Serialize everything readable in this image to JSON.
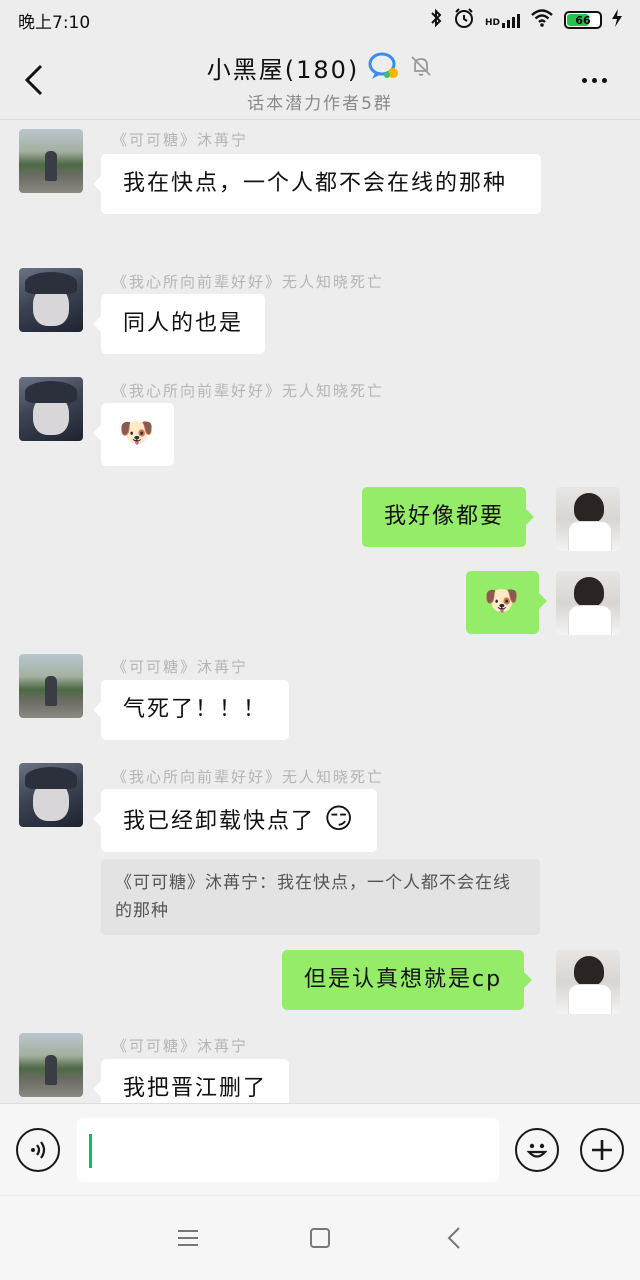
{
  "status_bar": {
    "time": "晚上7:10",
    "icons": [
      "bluetooth-icon",
      "alarm-icon",
      "hd-signal-icon",
      "wifi-icon",
      "battery-icon",
      "charging-icon"
    ],
    "network_label": "HD",
    "battery": "66",
    "battery_level_percent": 66
  },
  "header": {
    "title": "小黑屋(180)",
    "subtitle": "话本潜力作者5群",
    "back_icon": "chevron-left-icon",
    "more_icon": "more-dots-icon",
    "mute_icon": "bell-off-icon",
    "group_badge_icon": "group-chat-badge-icon"
  },
  "messages": [
    {
      "side": "left",
      "avatar": "road-girl",
      "sender": "《可可糖》沐苒宁",
      "text": "我在快点，一个人都不会在线的那种"
    },
    {
      "side": "left",
      "avatar": "anime-girl",
      "sender": "《我心所向前辈好好》无人知晓死亡",
      "text": "同人的也是"
    },
    {
      "side": "left",
      "avatar": "anime-girl",
      "sender": "《我心所向前辈好好》无人知晓死亡",
      "text": "🐶",
      "emoji": "doge-emoji"
    },
    {
      "side": "right",
      "avatar": "boy",
      "text": "我好像都要"
    },
    {
      "side": "right",
      "avatar": "boy",
      "text": "🐶",
      "emoji": "doge-emoji"
    },
    {
      "side": "left",
      "avatar": "road-girl",
      "sender": "《可可糖》沐苒宁",
      "text": "气死了！！！"
    },
    {
      "side": "left",
      "avatar": "anime-girl",
      "sender": "《我心所向前辈好好》无人知晓死亡",
      "text": "我已经卸载快点了",
      "trailing_emoji": "😏",
      "quote": "《可可糖》沐苒宁：我在快点，一个人都不会在线的那种"
    },
    {
      "side": "right",
      "avatar": "boy",
      "text": "但是认真想就是cp"
    },
    {
      "side": "left",
      "avatar": "road-girl",
      "sender": "《可可糖》沐苒宁",
      "text": "我把晋江删了"
    }
  ],
  "input_bar": {
    "voice_icon": "voice-icon",
    "emoji_icon": "emoji-face-icon",
    "plus_icon": "plus-circle-icon",
    "value": "",
    "placeholder": ""
  },
  "nav_bar": {
    "icons": [
      "menu-icon",
      "home-square-icon",
      "back-triangle-icon"
    ]
  },
  "colors": {
    "background": "#ededed",
    "bubble_self": "#95ec69",
    "bubble_other": "#ffffff",
    "caret": "#07c160",
    "sender_name": "#b5b5b5"
  }
}
